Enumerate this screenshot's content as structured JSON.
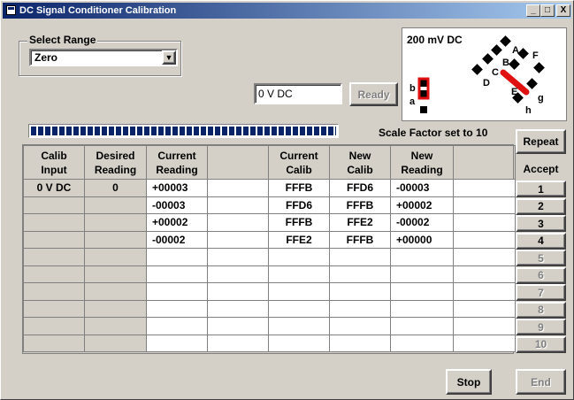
{
  "window": {
    "title": "DC Signal Conditioner Calibration",
    "minimize": "_",
    "maximize": "□",
    "close": "X"
  },
  "range": {
    "group_label": "Select Range",
    "selected": "Zero"
  },
  "input": {
    "value": "0 V DC"
  },
  "buttons": {
    "ready": "Ready",
    "repeat": "Repeat",
    "stop": "Stop",
    "end": "End"
  },
  "progress": {
    "fraction": 1.0
  },
  "scale_factor": "Scale Factor set to 10",
  "diagram": {
    "title": "200 mV DC",
    "labels": [
      "A",
      "B",
      "C",
      "D",
      "E",
      "F",
      "g",
      "h",
      "a",
      "b"
    ],
    "accent": "#e01010"
  },
  "table": {
    "headers": [
      "Calib\nInput",
      "Desired\nReading",
      "Current\nReading",
      "",
      "Current\nCalib",
      "New\nCalib",
      "New\nReading",
      ""
    ],
    "rows": [
      [
        "0 V DC",
        "0",
        "+00003",
        "",
        "FFFB",
        "FFD6",
        "-00003",
        ""
      ],
      [
        "",
        "",
        "-00003",
        "",
        "FFD6",
        "FFFB",
        "+00002",
        ""
      ],
      [
        "",
        "",
        "+00002",
        "",
        "FFFB",
        "FFE2",
        "-00002",
        ""
      ],
      [
        "",
        "",
        "-00002",
        "",
        "FFE2",
        "FFFB",
        "+00000",
        ""
      ],
      [
        "",
        "",
        "",
        "",
        "",
        "",
        "",
        ""
      ],
      [
        "",
        "",
        "",
        "",
        "",
        "",
        "",
        ""
      ],
      [
        "",
        "",
        "",
        "",
        "",
        "",
        "",
        ""
      ],
      [
        "",
        "",
        "",
        "",
        "",
        "",
        "",
        ""
      ],
      [
        "",
        "",
        "",
        "",
        "",
        "",
        "",
        ""
      ],
      [
        "",
        "",
        "",
        "",
        "",
        "",
        "",
        ""
      ]
    ]
  },
  "accept": {
    "label": "Accept",
    "buttons": [
      {
        "label": "1",
        "enabled": true
      },
      {
        "label": "2",
        "enabled": true
      },
      {
        "label": "3",
        "enabled": true
      },
      {
        "label": "4",
        "enabled": true
      },
      {
        "label": "5",
        "enabled": false
      },
      {
        "label": "6",
        "enabled": false
      },
      {
        "label": "7",
        "enabled": false
      },
      {
        "label": "8",
        "enabled": false
      },
      {
        "label": "9",
        "enabled": false
      },
      {
        "label": "10",
        "enabled": false
      }
    ]
  }
}
